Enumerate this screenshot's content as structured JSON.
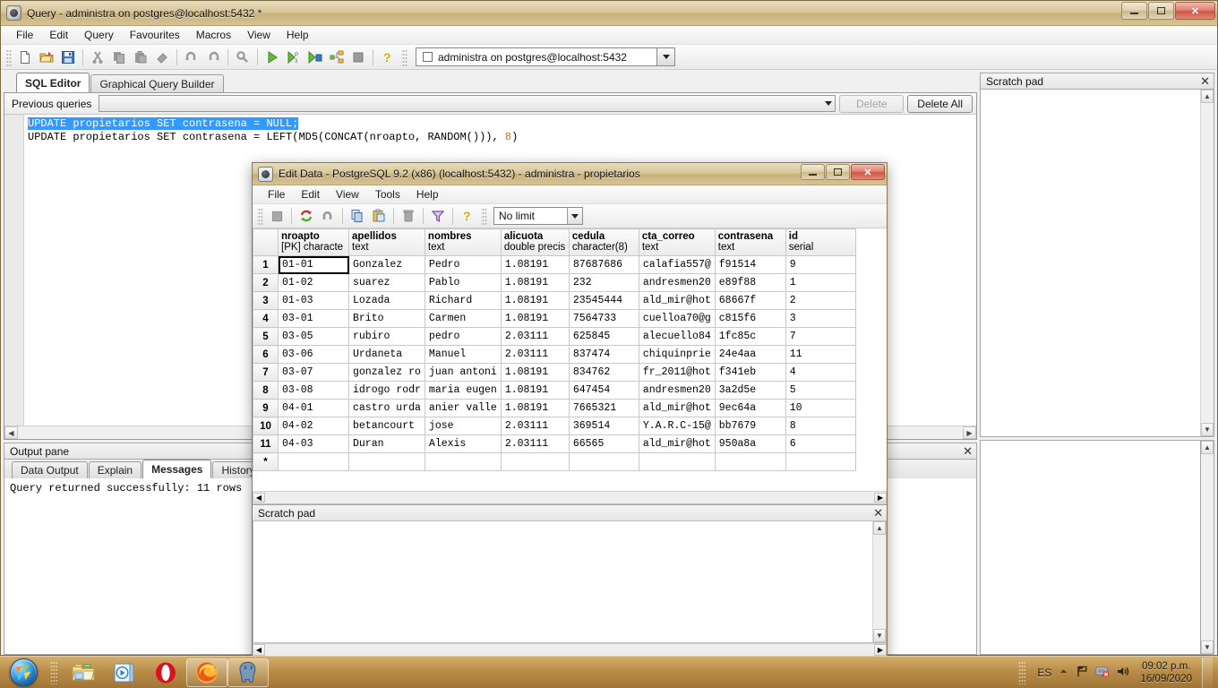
{
  "main_window": {
    "title": "Query - administra on postgres@localhost:5432 *",
    "icon": "pgadmin-query-icon",
    "window_buttons": {
      "minimize": "minimize",
      "maximize": "maximize",
      "close": "close"
    },
    "menu": [
      "File",
      "Edit",
      "Query",
      "Favourites",
      "Macros",
      "View",
      "Help"
    ],
    "toolbar_icons": [
      "new-file-icon",
      "open-folder-icon",
      "save-icon",
      "cut-icon",
      "copy-icon",
      "paste-icon",
      "clear-icon",
      "undo-icon",
      "redo-icon",
      "find-icon",
      "execute-query-icon",
      "execute-pgscript-icon",
      "execute-to-file-icon",
      "explain-query-icon",
      "stop-icon",
      "help-icon"
    ],
    "connection": {
      "label": "administra on postgres@localhost:5432",
      "checkbox": false
    }
  },
  "tabs": [
    {
      "label": "SQL Editor",
      "active": true
    },
    {
      "label": "Graphical Query Builder",
      "active": false
    }
  ],
  "previous_queries": {
    "label": "Previous queries",
    "value": "",
    "delete_label": "Delete",
    "delete_enabled": false,
    "delete_all_label": "Delete All",
    "delete_all_enabled": true
  },
  "sql": {
    "line1_selected": "UPDATE propietarios SET contrasena = NULL;",
    "line2_prefix": "UPDATE propietarios SET contrasena = LEFT(MD5(CONCAT(nroapto, RANDOM())), ",
    "line2_number": "8",
    "line2_suffix": ")"
  },
  "output_pane": {
    "title": "Output pane",
    "tabs": [
      {
        "label": "Data Output",
        "active": false
      },
      {
        "label": "Explain",
        "active": false
      },
      {
        "label": "Messages",
        "active": true
      },
      {
        "label": "History",
        "active": false
      }
    ],
    "message": "Query returned successfully: 11 rows"
  },
  "scratch_pad_main": {
    "title": "Scratch pad",
    "close": "✕",
    "content": ""
  },
  "edit_data_window": {
    "title": "Edit Data - PostgreSQL 9.2 (x86) (localhost:5432) - administra - propietarios",
    "icon": "edit-data-grid-icon",
    "menu": [
      "File",
      "Edit",
      "View",
      "Tools",
      "Help"
    ],
    "toolbar_icons": [
      "save-icon",
      "refresh-icon",
      "undo-icon",
      "copy-icon",
      "paste-icon",
      "delete-row-icon",
      "filter-icon",
      "help-icon"
    ],
    "limit_combo": {
      "value": "No limit"
    },
    "scratch_pad": {
      "title": "Scratch pad",
      "close": "✕",
      "content": ""
    }
  },
  "grid": {
    "columns": [
      {
        "name": "nroapto",
        "type": "[PK] characte",
        "class": "col-nroapto"
      },
      {
        "name": "apellidos",
        "type": "text",
        "class": "col-apellidos"
      },
      {
        "name": "nombres",
        "type": "text",
        "class": "col-nombres"
      },
      {
        "name": "alicuota",
        "type": "double precis",
        "class": "col-alicuota"
      },
      {
        "name": "cedula",
        "type": "character(8)",
        "class": "col-cedula"
      },
      {
        "name": "cta_correo",
        "type": "text",
        "class": "col-cta"
      },
      {
        "name": "contrasena",
        "type": "text",
        "class": "col-contra"
      },
      {
        "name": "id",
        "type": "serial",
        "class": "col-id"
      }
    ],
    "rows": [
      {
        "n": "1",
        "cells": [
          "01-01",
          "Gonzalez",
          "Pedro",
          "1.08191",
          "87687686",
          "calafia557@",
          "f91514",
          "9"
        ]
      },
      {
        "n": "2",
        "cells": [
          "01-02",
          "suarez",
          "Pablo",
          "1.08191",
          "232",
          "andresmen20",
          "e89f88",
          "1"
        ]
      },
      {
        "n": "3",
        "cells": [
          "01-03",
          "Lozada",
          "Richard",
          "1.08191",
          "23545444",
          "ald_mir@hot",
          "68667f",
          "2"
        ]
      },
      {
        "n": "4",
        "cells": [
          "03-01",
          "Brito",
          "Carmen",
          "1.08191",
          "7564733",
          "cuelloa70@g",
          "c815f6",
          "3"
        ]
      },
      {
        "n": "5",
        "cells": [
          "03-05",
          "rubiro",
          "pedro",
          "2.03111",
          "625845",
          "alecuello84",
          "1fc85c",
          "7"
        ]
      },
      {
        "n": "6",
        "cells": [
          "03-06",
          "Urdaneta",
          "Manuel",
          "2.03111",
          "837474",
          "chiquinprie",
          "24e4aa",
          "11"
        ]
      },
      {
        "n": "7",
        "cells": [
          "03-07",
          "gonzalez ro",
          "juan antoni",
          "1.08191",
          "834762",
          "fr_2011@hot",
          "f341eb",
          "4"
        ]
      },
      {
        "n": "8",
        "cells": [
          "03-08",
          "idrogo rodr",
          "maria eugen",
          "1.08191",
          "647454",
          "andresmen20",
          "3a2d5e",
          "5"
        ]
      },
      {
        "n": "9",
        "cells": [
          "04-01",
          "castro urda",
          "anier valle",
          "1.08191",
          "7665321",
          "ald_mir@hot",
          "9ec64a",
          "10"
        ]
      },
      {
        "n": "10",
        "cells": [
          "04-02",
          "betancourt",
          "jose",
          "2.03111",
          "369514",
          "Y.A.R.C-15@",
          "bb7679",
          "8"
        ]
      },
      {
        "n": "11",
        "cells": [
          "04-03",
          "Duran",
          "Alexis",
          "2.03111",
          "66565",
          "ald_mir@hot",
          "950a8a",
          "6"
        ]
      }
    ],
    "new_row_marker": "*",
    "selected_cell": {
      "row": 0,
      "col": 0
    }
  },
  "taskbar": {
    "start": "start-orb",
    "items": [
      {
        "icon": "windows-explorer-icon",
        "pinned": false
      },
      {
        "icon": "windows-media-player-icon",
        "pinned": false
      },
      {
        "icon": "opera-browser-icon",
        "pinned": false
      },
      {
        "icon": "firefox-browser-icon",
        "pinned": true
      },
      {
        "icon": "postgresql-elephant-icon",
        "pinned": true
      }
    ],
    "tray": {
      "language": "ES",
      "icons": [
        "show-hidden-icons",
        "network-icon",
        "action-center-icon",
        "volume-icon"
      ],
      "time": "09:02 p.m.",
      "date": "16/09/2020"
    }
  },
  "colors": {
    "selection_blue": "#3399ff",
    "aero_gold": "#c9a35e",
    "close_red": "#cf5642"
  }
}
